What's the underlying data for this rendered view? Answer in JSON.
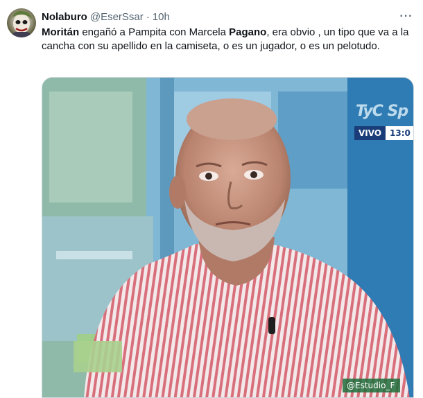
{
  "tweet": {
    "author": {
      "display_name": "Nolaburo",
      "handle": "@EserSsar",
      "separator": "·",
      "time": "10h"
    },
    "more_icon": "more-horizontal-icon",
    "text_segments": [
      {
        "text": "Moritán",
        "bold": true
      },
      {
        "text": " engañó a Pampita con Marcela ",
        "bold": false
      },
      {
        "text": "Pagano",
        "bold": true
      },
      {
        "text": ", era obvio , un tipo que va a la cancha con su apellido en la camiseta, o es un jugador, o es un pelotudo.",
        "bold": false
      }
    ],
    "media": {
      "overlay": {
        "channel_logo": "TyC Sp",
        "live_label": "VIVO",
        "clock": "13:0",
        "social_tag": "@Estudio_F"
      }
    }
  },
  "colors": {
    "text_primary": "#0f1419",
    "text_secondary": "#536471",
    "border": "#cfd9de",
    "tv_blue": "#1a3d7a"
  }
}
